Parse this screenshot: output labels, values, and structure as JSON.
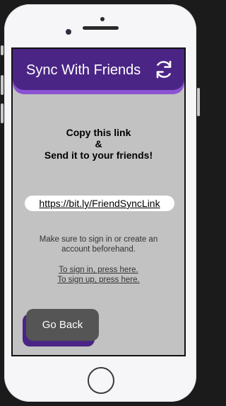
{
  "header": {
    "title": "Sync With Friends",
    "sync_icon": "refresh-icon"
  },
  "main": {
    "instruction_line1": "Copy this link",
    "instruction_line2": "&",
    "instruction_line3": "Send it to your friends!",
    "share_link": "https://bit.ly/FriendSyncLink",
    "notice": "Make sure to sign in or create an account beforehand.",
    "sign_in_link": "To sign in, press here.",
    "sign_up_link": "To sign up, press here."
  },
  "footer": {
    "back_label": "Go Back"
  },
  "colors": {
    "header_primary": "#4a2585",
    "header_accent": "#8b52d1",
    "screen_background": "#c2c2c2",
    "button_background": "#555555"
  }
}
